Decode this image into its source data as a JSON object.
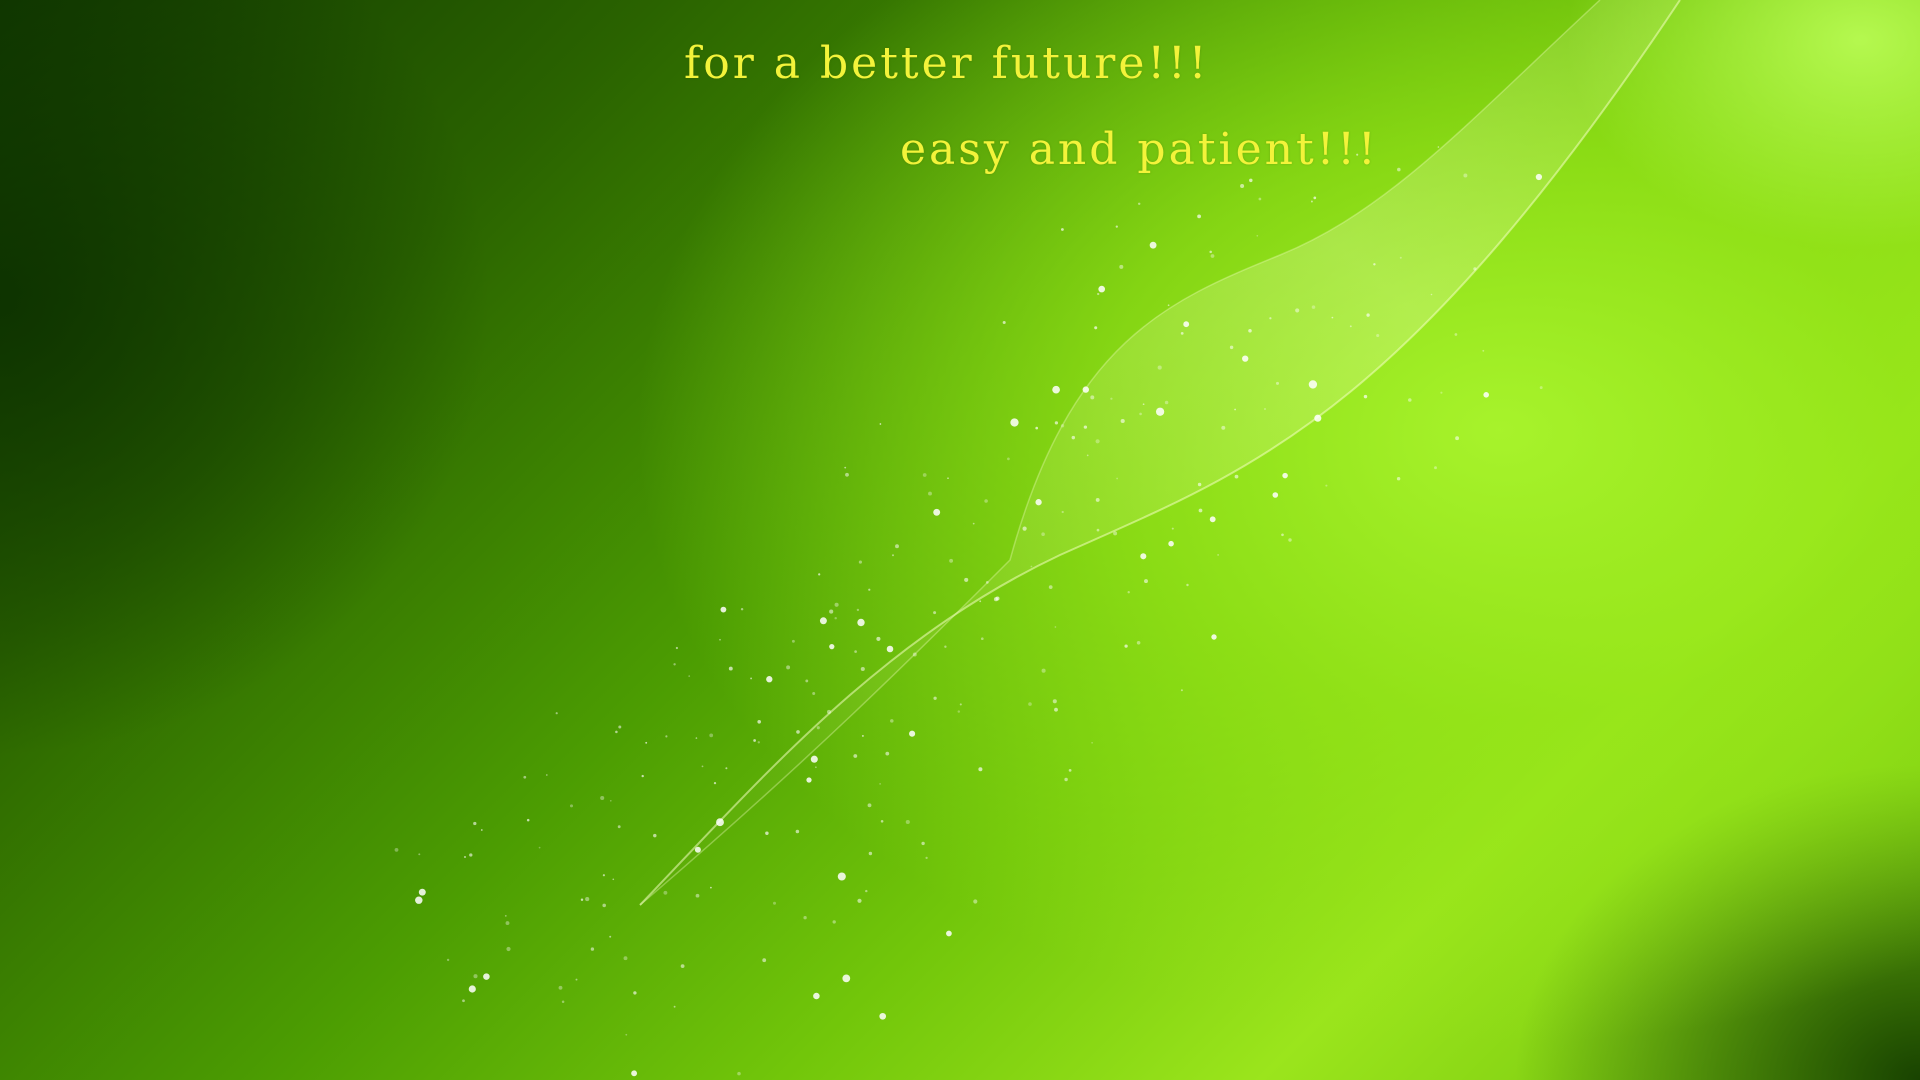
{
  "desktop": {
    "lines": [
      "for a better future!!!",
      "easy and patient!!!"
    ],
    "colors": {
      "text": "#f3f33a",
      "background_dark": "#123a00",
      "background_light": "#a8f02d",
      "wave": "#e6ff9a"
    }
  }
}
